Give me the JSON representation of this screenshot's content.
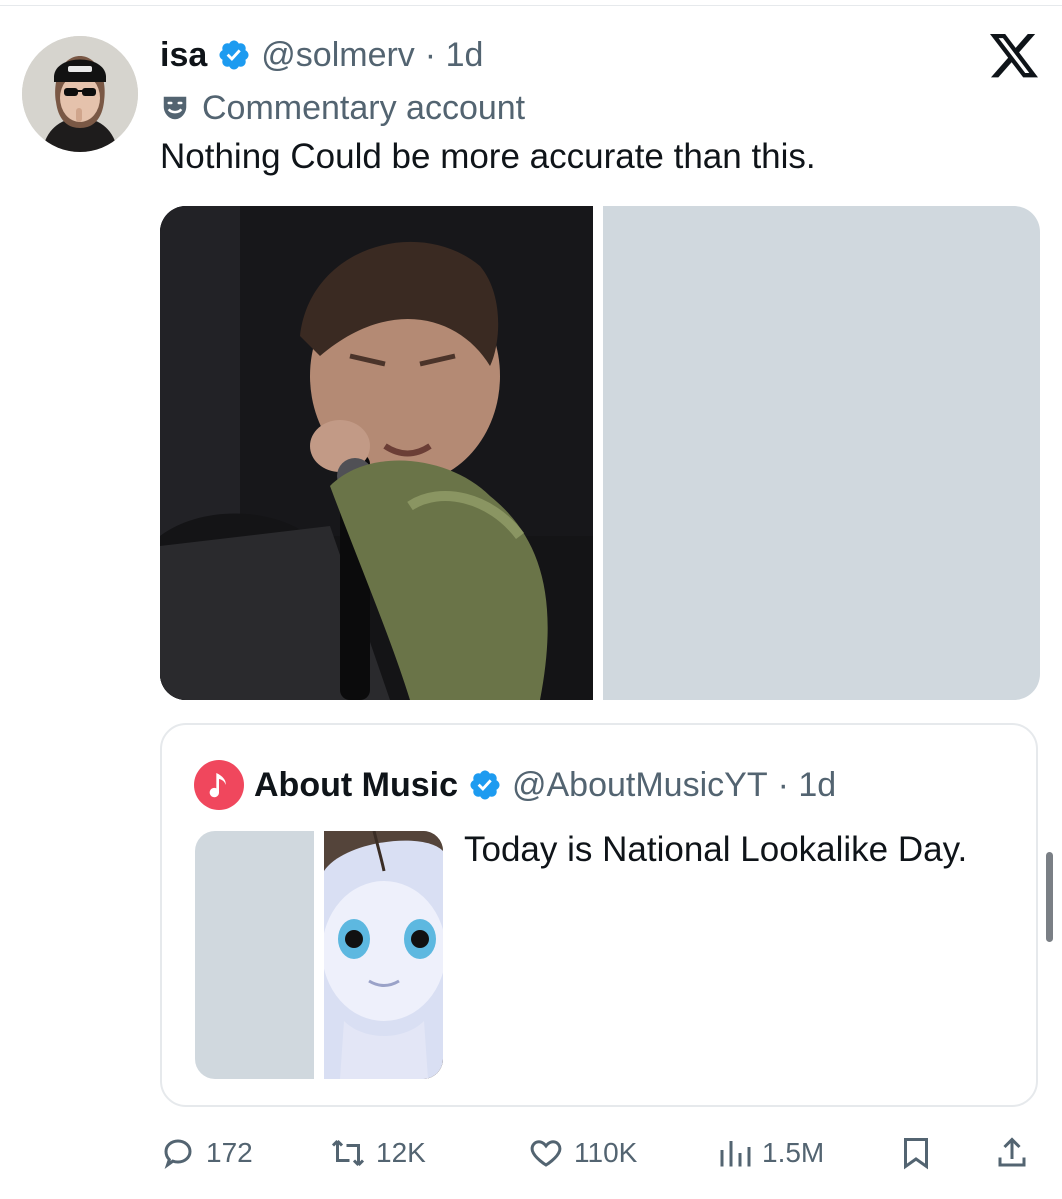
{
  "tweet": {
    "display_name": "isa",
    "handle": "@solmerv",
    "time": "· 1d",
    "label": "Commentary account",
    "text": "Nothing Could be more accurate than this."
  },
  "quote": {
    "display_name": "About Music",
    "handle": "@AboutMusicYT",
    "time": "· 1d",
    "text": "Today is National Lookalike Day."
  },
  "actions": {
    "replies": "172",
    "reposts": "12K",
    "likes": "110K",
    "views": "1.5M"
  },
  "icons": {
    "verified": "verified-badge-icon",
    "x_logo": "x-logo-icon",
    "label": "theater-mask-icon",
    "reply": "reply-icon",
    "repost": "repost-icon",
    "like": "heart-icon",
    "views": "views-icon",
    "bookmark": "bookmark-icon",
    "share": "share-icon"
  },
  "colors": {
    "verified": "#1d9bf0",
    "secondary_text": "#536471",
    "placeholder": "#d0d8de",
    "quote_avatar": "#f0475d"
  }
}
